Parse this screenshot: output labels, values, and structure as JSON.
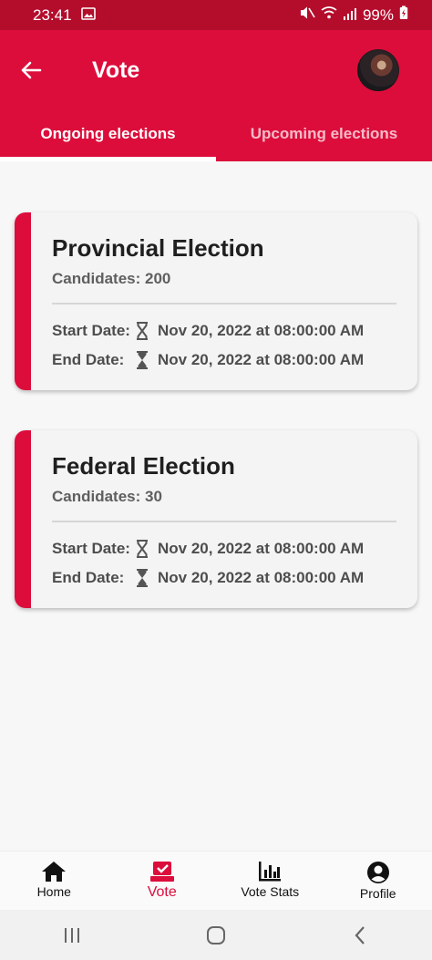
{
  "status_bar": {
    "time": "23:41",
    "battery": "99%"
  },
  "header": {
    "title": "Vote"
  },
  "tabs": [
    {
      "label": "Ongoing elections",
      "active": true
    },
    {
      "label": "Upcoming elections",
      "active": false
    }
  ],
  "elections": [
    {
      "name": "Provincial Election",
      "candidates": "Candidates: 200",
      "start_label": "Start Date:",
      "start_value": "Nov 20, 2022 at 08:00:00 AM",
      "end_label": "End Date:",
      "end_value": "Nov 20, 2022 at 08:00:00 AM"
    },
    {
      "name": "Federal Election",
      "candidates": "Candidates: 30",
      "start_label": "Start Date:",
      "start_value": "Nov 20, 2022 at 08:00:00 AM",
      "end_label": "End Date:",
      "end_value": "Nov 20, 2022 at 08:00:00 AM"
    }
  ],
  "bottom_nav": [
    {
      "label": "Home",
      "icon": "home-icon"
    },
    {
      "label": "Vote",
      "icon": "vote-icon",
      "active": true
    },
    {
      "label": "Vote Stats",
      "icon": "bar-chart-icon"
    },
    {
      "label": "Profile",
      "icon": "account-circle-icon"
    }
  ],
  "colors": {
    "primary": "#dc0d3b",
    "status_bar": "#b40d2c"
  }
}
